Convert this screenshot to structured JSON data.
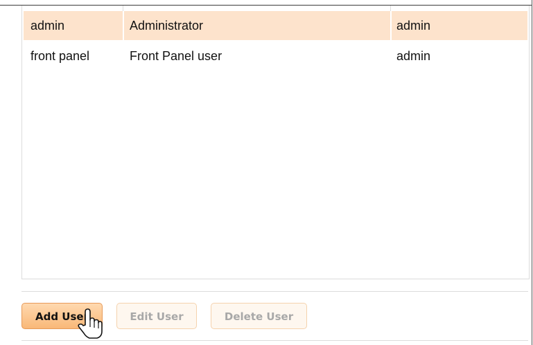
{
  "users_table": {
    "rows": [
      {
        "username": "admin",
        "full_name": "Administrator",
        "role": "admin",
        "selected": true
      },
      {
        "username": "front panel",
        "full_name": "Front Panel user",
        "role": "admin",
        "selected": false
      }
    ]
  },
  "actions": {
    "add_label": "Add User",
    "edit_label": "Edit User",
    "delete_label": "Delete User"
  },
  "colors": {
    "selected_row": "#fde3cc",
    "primary_button": "#f9b878",
    "disabled_button": "#fef7ef"
  },
  "icons": {
    "cursor": "hand-pointer-icon"
  }
}
